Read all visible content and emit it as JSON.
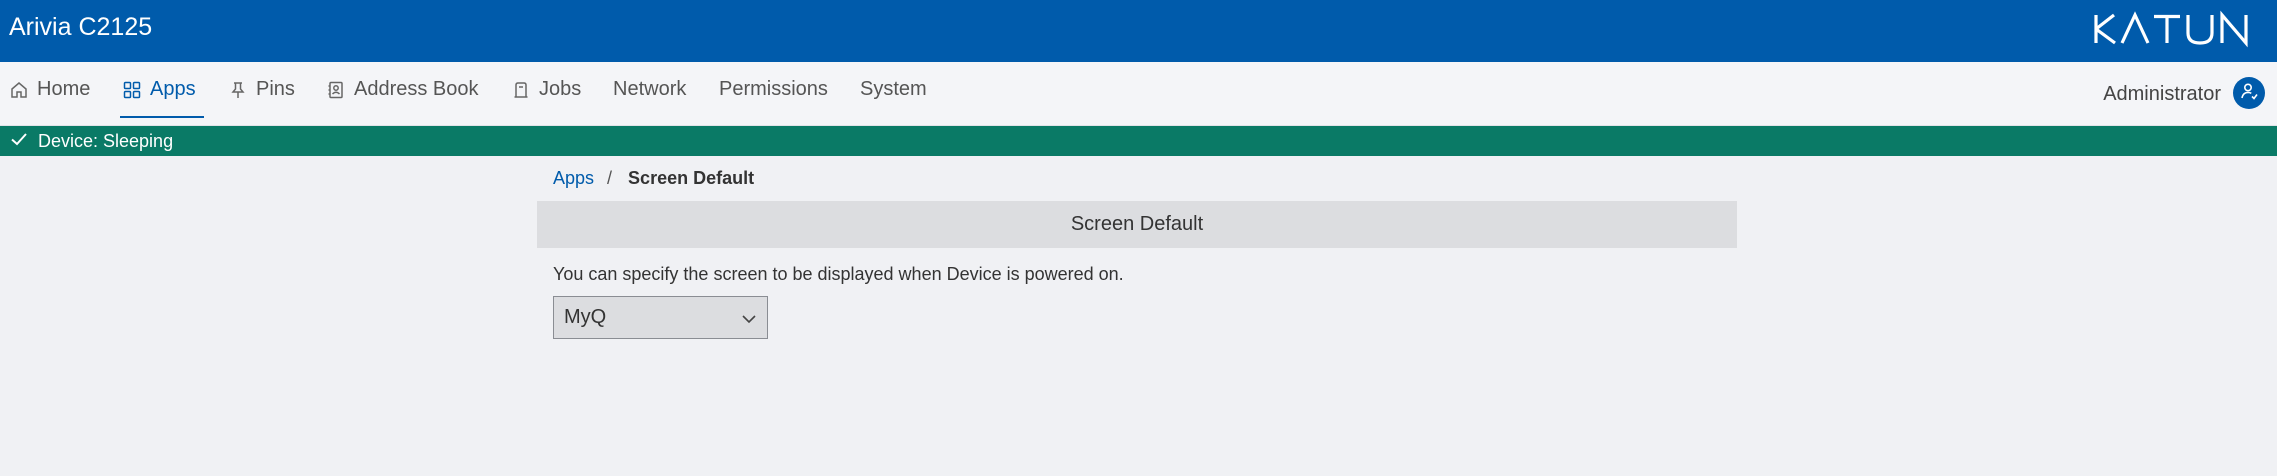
{
  "header": {
    "title": "Arivia C2125",
    "brand": "KATUN"
  },
  "nav": {
    "items": [
      {
        "label": "Home",
        "icon": "home-icon"
      },
      {
        "label": "Apps",
        "icon": "apps-icon",
        "active": true
      },
      {
        "label": "Pins",
        "icon": "pin-icon"
      },
      {
        "label": "Address Book",
        "icon": "address-book-icon"
      },
      {
        "label": "Jobs",
        "icon": "jobs-icon"
      },
      {
        "label": "Network"
      },
      {
        "label": "Permissions"
      },
      {
        "label": "System"
      }
    ],
    "user": "Administrator"
  },
  "status": {
    "text": "Device: Sleeping",
    "color": "#0a7a66"
  },
  "breadcrumb": {
    "parent": "Apps",
    "separator": "/",
    "current": "Screen Default"
  },
  "section": {
    "title": "Screen Default",
    "description": "You can specify the screen to be displayed when Device is powered on.",
    "select_value": "MyQ"
  },
  "colors": {
    "brand_blue": "#005bab",
    "status_green": "#0a7a66"
  }
}
